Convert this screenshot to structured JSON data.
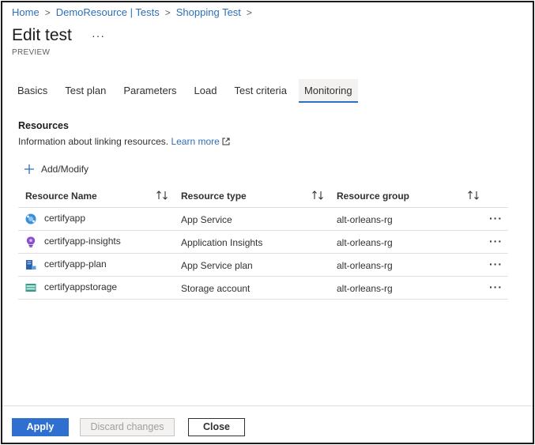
{
  "breadcrumb": {
    "items": [
      "Home",
      "DemoResource | Tests",
      "Shopping Test"
    ],
    "separator": ">"
  },
  "header": {
    "title": "Edit test",
    "more": "···",
    "subtitle": "PREVIEW"
  },
  "tabs": [
    {
      "label": "Basics",
      "active": false
    },
    {
      "label": "Test plan",
      "active": false
    },
    {
      "label": "Parameters",
      "active": false
    },
    {
      "label": "Load",
      "active": false
    },
    {
      "label": "Test criteria",
      "active": false
    },
    {
      "label": "Monitoring",
      "active": true
    }
  ],
  "resources": {
    "title": "Resources",
    "description": "Information about linking resources.",
    "learn_more": "Learn more",
    "add_label": "Add/Modify"
  },
  "grid": {
    "columns": [
      "Resource Name",
      "Resource type",
      "Resource group"
    ],
    "sort_icon": "↑↓",
    "row_more": "···",
    "rows": [
      {
        "name": "certifyapp",
        "type": "App Service",
        "group": "alt-orleans-rg",
        "icon": "app-service-icon"
      },
      {
        "name": "certifyapp-insights",
        "type": "Application Insights",
        "group": "alt-orleans-rg",
        "icon": "application-insights-icon"
      },
      {
        "name": "certifyapp-plan",
        "type": "App Service plan",
        "group": "alt-orleans-rg",
        "icon": "app-service-plan-icon"
      },
      {
        "name": "certifyappstorage",
        "type": "Storage account",
        "group": "alt-orleans-rg",
        "icon": "storage-account-icon"
      }
    ]
  },
  "footer": {
    "apply": "Apply",
    "discard": "Discard changes",
    "close": "Close"
  },
  "colors": {
    "accent": "#2e6fd0",
    "link": "#2e6fb7",
    "text": "#323130"
  }
}
